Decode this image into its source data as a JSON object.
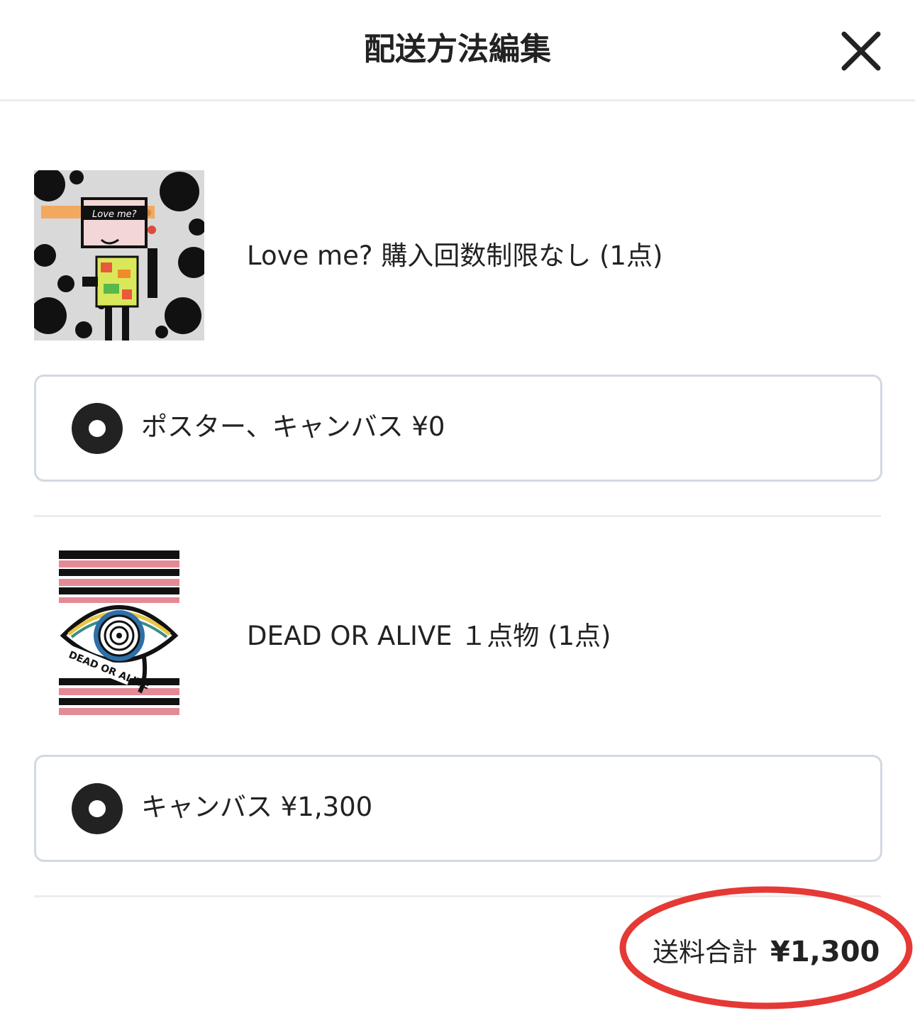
{
  "header": {
    "title": "配送方法編集",
    "close_icon": "close-icon"
  },
  "items": [
    {
      "name": "Love me? 購入回数制限なし (1点)",
      "thumbnail_text": "Love me?",
      "shipping_option": {
        "label": "ポスター、キャンバス ¥0",
        "selected": true
      }
    },
    {
      "name": "DEAD OR ALIVE １点物 (1点)",
      "thumbnail_text": "DEAD OR ALIVE",
      "shipping_option": {
        "label": "キャンバス ¥1,300",
        "selected": true
      }
    }
  ],
  "summary": {
    "label": "送料合計",
    "value": "¥1,300",
    "highlight_color": "#e53935"
  },
  "colors": {
    "text": "#222222",
    "border": "#d3d9e1",
    "divider": "#ececec",
    "radio": "#222222"
  }
}
